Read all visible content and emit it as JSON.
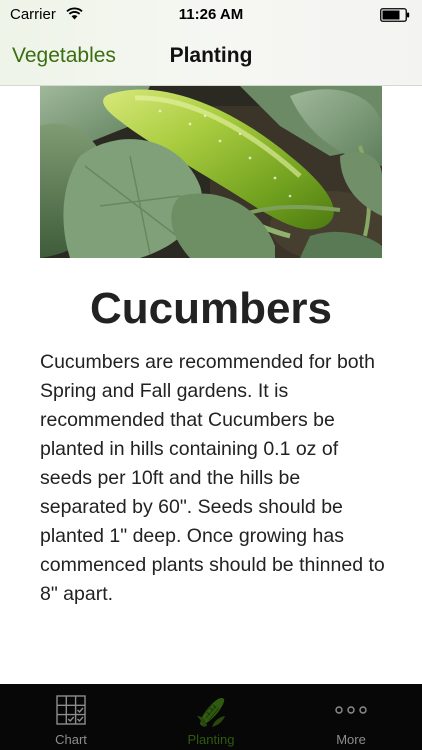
{
  "status_bar": {
    "carrier": "Carrier",
    "time": "11:26 AM",
    "icons": [
      "wifi-icon",
      "battery-icon"
    ]
  },
  "nav": {
    "back_label": "Vegetables",
    "title": "Planting",
    "accent_color": "#3b6e12"
  },
  "vegetable": {
    "image": "cucumber-photo",
    "name": "Cucumbers",
    "description": "Cucumbers are recommended for both Spring and Fall gardens. It is recommended that Cucumbers be planted in hills containing 0.1 oz of seeds per 10ft and the hills be separated by 60\". Seeds should be planted 1\" deep. Once growing has commenced plants should be thinned to 8\" apart."
  },
  "tab_bar": {
    "background": "#070707",
    "tabs": [
      {
        "label": "Chart",
        "icon": "grid-chart-icon",
        "selected": false
      },
      {
        "label": "Planting",
        "icon": "corn-icon",
        "selected": true
      },
      {
        "label": "More",
        "icon": "more-dots-icon",
        "selected": false
      }
    ]
  }
}
